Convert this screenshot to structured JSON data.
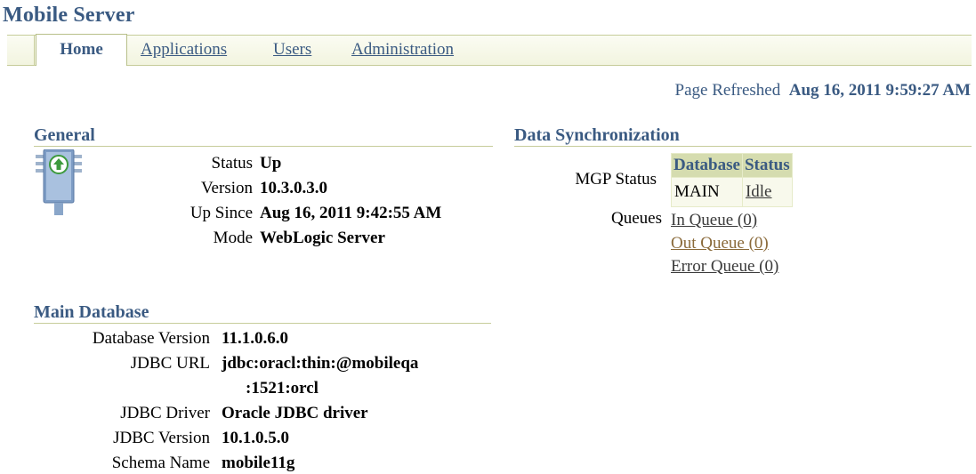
{
  "app_title": "Mobile Server",
  "tabs": {
    "active": "Home",
    "others": [
      "Applications",
      "Users",
      "Administration"
    ]
  },
  "page_refreshed": {
    "label": "Page Refreshed",
    "value": "Aug 16, 2011 9:59:27 AM"
  },
  "general": {
    "heading": "General",
    "icon": "server-status-up-icon",
    "status_label": "Status",
    "status": "Up",
    "version_label": "Version",
    "version": "10.3.0.3.0",
    "upsince_label": "Up Since",
    "upsince": "Aug 16, 2011 9:42:55 AM",
    "mode_label": "Mode",
    "mode": "WebLogic Server"
  },
  "data_sync": {
    "heading": "Data Synchronization",
    "mgp_status_label": "MGP Status",
    "table_headers": [
      "Database",
      "Status"
    ],
    "table_row": {
      "database": "MAIN",
      "status": "Idle"
    },
    "queues_label": "Queues",
    "queues": [
      "In Queue (0)",
      "Out Queue (0)",
      "Error Queue (0)"
    ]
  },
  "main_database": {
    "heading": "Main Database",
    "db_version_label": "Database Version",
    "db_version": "11.1.0.6.0",
    "jdbc_url_label": "JDBC URL",
    "jdbc_url_line1": "jdbc:oracl:thin:@mobileqa",
    "jdbc_url_line2": ":1521:orcl",
    "jdbc_driver_label": "JDBC Driver",
    "jdbc_driver": "Oracle JDBC driver",
    "jdbc_version_label": "JDBC Version",
    "jdbc_version": "10.1.0.5.0",
    "schema_label": "Schema Name",
    "schema": "mobile11g"
  },
  "colors": {
    "heading_blue": "#3a5a82",
    "rule_olive": "#c6cc9a",
    "table_header_bg": "#d5dcaf"
  }
}
